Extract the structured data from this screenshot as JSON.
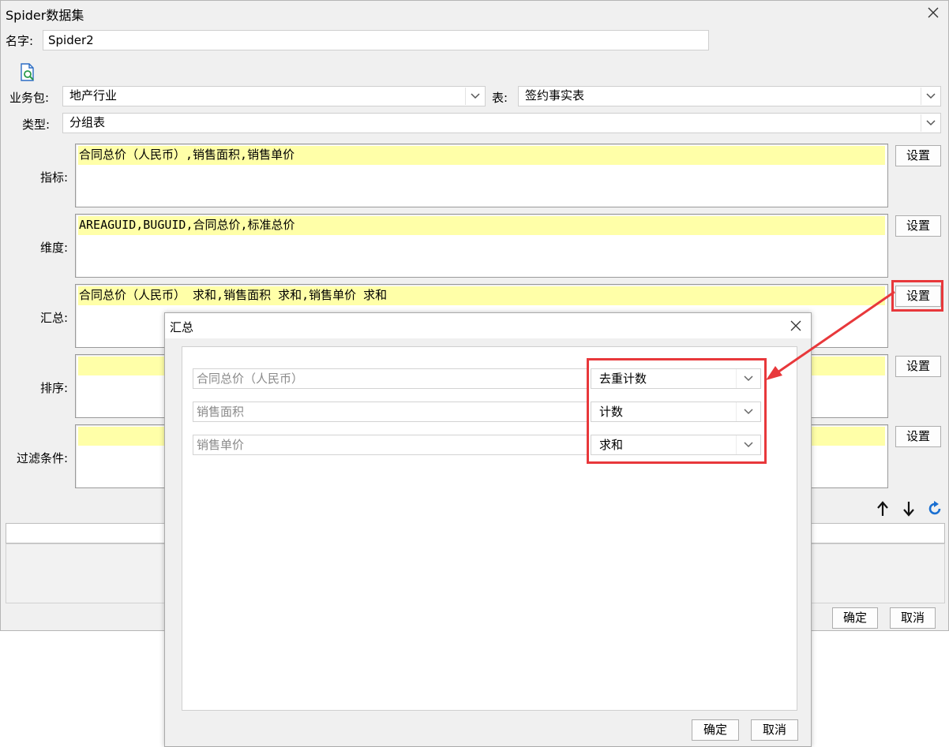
{
  "window": {
    "title": "Spider数据集",
    "name_label": "名字:",
    "name_value": "Spider2",
    "preview_icon": "document-preview-icon",
    "close_icon": "close-icon"
  },
  "form": {
    "package_label": "业务包:",
    "package_value": "地产行业",
    "table_label": "表:",
    "table_value": "签约事实表",
    "type_label": "类型:",
    "type_value": "分组表"
  },
  "sections": [
    {
      "label": "指标:",
      "value": "合同总价（人民币）,销售面积,销售单价",
      "button": "设置"
    },
    {
      "label": "维度:",
      "value": "AREAGUID,BUGUID,合同总价,标准总价",
      "button": "设置"
    },
    {
      "label": "汇总:",
      "value": "合同总价（人民币） 求和,销售面积 求和,销售单价 求和",
      "button": "设置"
    },
    {
      "label": "排序:",
      "value": "",
      "button": "设置"
    },
    {
      "label": "过滤条件:",
      "value": "",
      "button": "设置"
    }
  ],
  "toolbar": {
    "up_icon": "arrow-up-icon",
    "down_icon": "arrow-down-icon",
    "refresh_icon": "refresh-icon"
  },
  "footer": {
    "ok": "确定",
    "cancel": "取消"
  },
  "dialog": {
    "title": "汇总",
    "rows": [
      {
        "field": "合同总价（人民币）",
        "agg": "去重计数"
      },
      {
        "field": "销售面积",
        "agg": "计数"
      },
      {
        "field": "销售单价",
        "agg": "求和"
      }
    ],
    "ok": "确定",
    "cancel": "取消"
  },
  "colors": {
    "highlight": "#ffffa8",
    "annotation_red": "#e8383b",
    "refresh_blue": "#1a6fd1"
  }
}
